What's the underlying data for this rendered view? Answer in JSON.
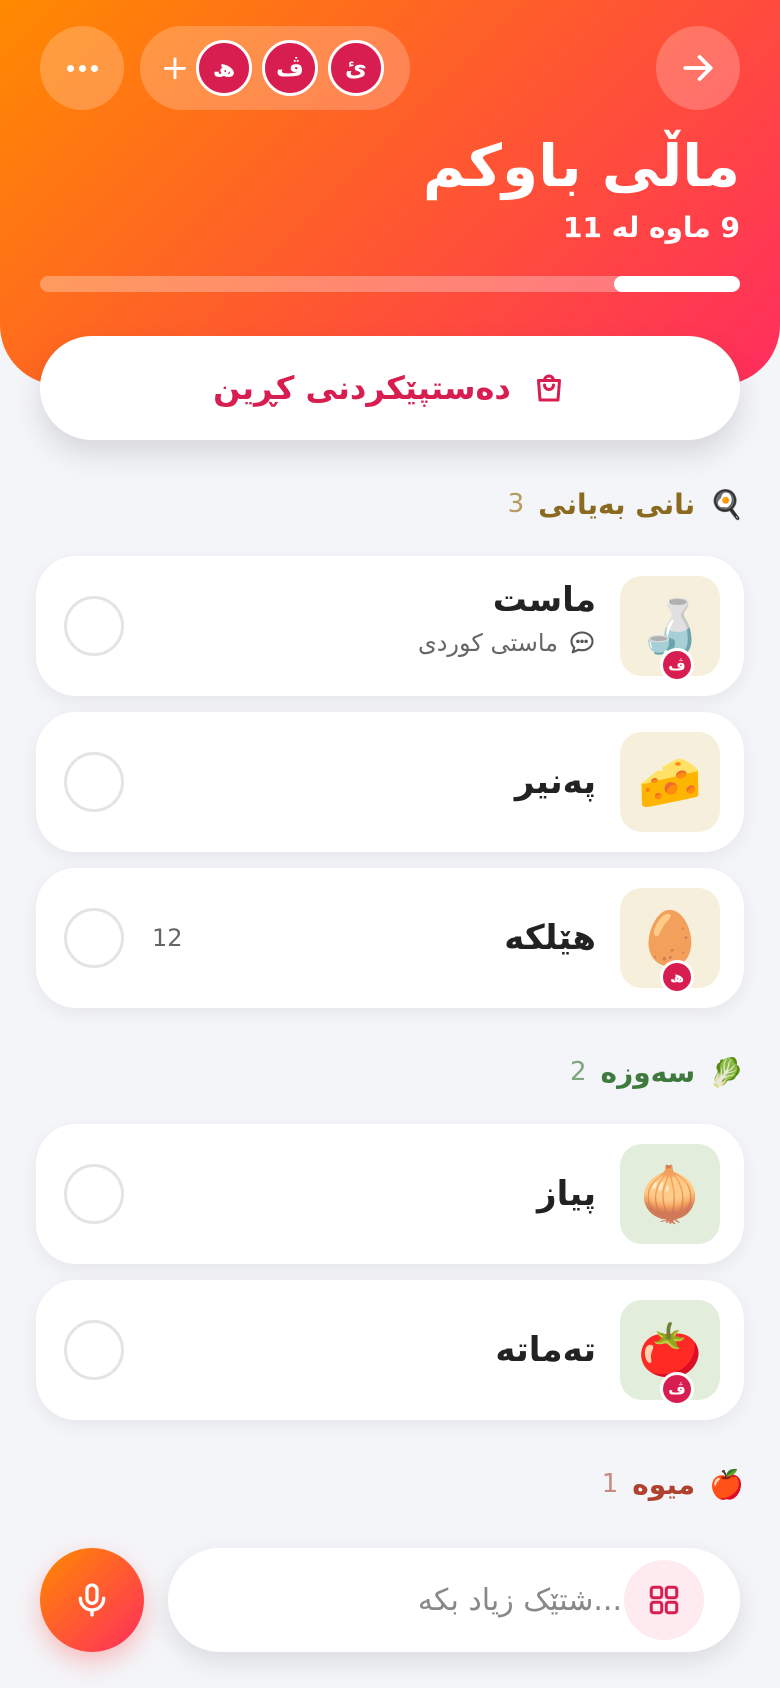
{
  "header": {
    "title": "ماڵی باوکم",
    "date": "9 ماوە لە 11",
    "progress": 0.18,
    "members": [
      {
        "initial": "ئ"
      },
      {
        "initial": "ڤ"
      },
      {
        "initial": "ھ"
      }
    ],
    "add_member_label": "+"
  },
  "start_button": {
    "label": "دەستپێکردنی کڕین",
    "icon": "shopping-bag-icon"
  },
  "sections": [
    {
      "name": "نانی بەیانی",
      "emoji": "🍳",
      "count": "3",
      "color": "#8a6a1e",
      "items": [
        {
          "name": "ماست",
          "emoji": "🍶",
          "note": "ماستی کوردی",
          "badge": "ڤ",
          "qty": "",
          "thumb_bg": "#f6efdc"
        },
        {
          "name": "پەنیر",
          "emoji": "🧀",
          "note": "",
          "badge": "",
          "qty": "",
          "thumb_bg": "#f6efdc"
        },
        {
          "name": "هێلکە",
          "emoji": "🥚",
          "note": "",
          "badge": "ھ",
          "qty": "12",
          "thumb_bg": "#f6efdc"
        }
      ]
    },
    {
      "name": "سەوزە",
      "emoji": "🥬",
      "count": "2",
      "color": "#3e7a3e",
      "items": [
        {
          "name": "پیاز",
          "emoji": "🧅",
          "note": "",
          "badge": "",
          "qty": "",
          "thumb_bg": "#e2eedb"
        },
        {
          "name": "تەماتە",
          "emoji": "🍅",
          "note": "",
          "badge": "ڤ",
          "qty": "",
          "thumb_bg": "#e2eedb"
        }
      ]
    },
    {
      "name": "میوە",
      "emoji": "🍎",
      "count": "1",
      "color": "#b0412e",
      "items": []
    }
  ],
  "add_bar": {
    "placeholder": "...شتێک زیاد بکە"
  },
  "colors": {
    "accent": "#d81e50",
    "gradient_start": "#ff8a00",
    "gradient_end": "#ff2d5e"
  }
}
